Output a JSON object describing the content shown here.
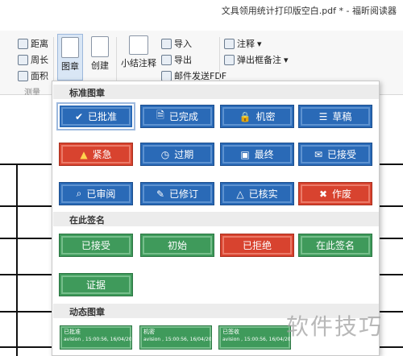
{
  "window": {
    "title": "文具领用统计打印版空白.pdf * - 福昕阅读器"
  },
  "ribbon": {
    "measure": {
      "distance": "距离",
      "perimeter": "周长",
      "area": "面积",
      "group_label": "测量"
    },
    "stamp_label": "图章",
    "create_label": "创建",
    "summary_label": "小结注释",
    "import_label": "导入",
    "export_label": "导出",
    "email_label": "邮件发送FDF",
    "annotation_label": "注释",
    "popup_label": "弹出框备注"
  },
  "stamps": {
    "standard_header": "标准图章",
    "standard": [
      {
        "label": "已批准",
        "icon": "checkmark-icon",
        "color": "blue"
      },
      {
        "label": "已完成",
        "icon": "document-check-icon",
        "color": "blue"
      },
      {
        "label": "机密",
        "icon": "lock-icon",
        "color": "blue"
      },
      {
        "label": "草稿",
        "icon": "document-lines-icon",
        "color": "blue"
      },
      {
        "label": "紧急",
        "icon": "warning-icon",
        "color": "red"
      },
      {
        "label": "过期",
        "icon": "clock-icon",
        "color": "blue"
      },
      {
        "label": "最终",
        "icon": "final-stamp-icon",
        "color": "blue"
      },
      {
        "label": "已接受",
        "icon": "envelope-icon",
        "color": "blue"
      },
      {
        "label": "已审阅",
        "icon": "magnifier-icon",
        "color": "blue"
      },
      {
        "label": "已修订",
        "icon": "pen-icon",
        "color": "blue"
      },
      {
        "label": "已核实",
        "icon": "triangle-icon",
        "color": "blue"
      },
      {
        "label": "作废",
        "icon": "x-icon",
        "color": "red"
      }
    ],
    "sign_header": "在此签名",
    "sign": [
      {
        "label": "已接受",
        "color": "green"
      },
      {
        "label": "初始",
        "color": "green"
      },
      {
        "label": "已拒绝",
        "color": "red"
      },
      {
        "label": "在此签名",
        "color": "green"
      },
      {
        "label": "证据",
        "color": "green"
      }
    ],
    "dynamic_header": "动态图章",
    "dynamic": [
      {
        "label": "已批准",
        "sub": "avision , 15:00:56, 16/04/2014"
      },
      {
        "label": "机密",
        "sub": "avision , 15:00:56, 16/04/2014"
      },
      {
        "label": "已签收",
        "sub": "avision , 15:00:56, 16/04/2014"
      }
    ]
  },
  "watermark": "软件技巧"
}
